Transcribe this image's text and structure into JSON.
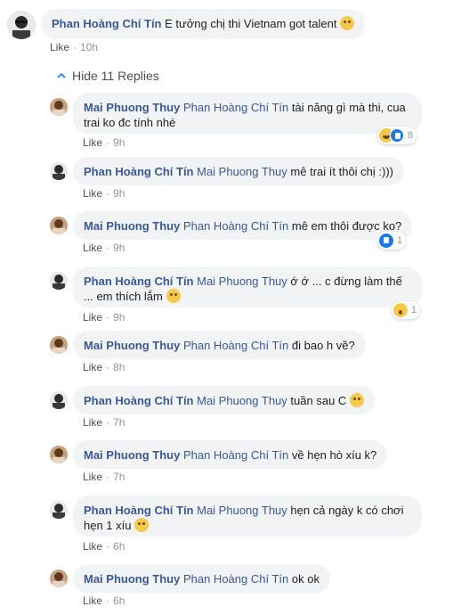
{
  "top_comment": {
    "author": "Phan Hoàng Chí Tín",
    "text": "E tưởng chị thi Vietnam got talent",
    "like_label": "Like",
    "time": "10h"
  },
  "hide_replies_label": "Hide 11 Replies",
  "replies": [
    {
      "author": "Mai Phuong Thuy",
      "mention": "Phan Hoàng Chí Tín",
      "line1": "tài năng gì mà thi, cua",
      "line2": "trai ko đc tính nhé",
      "like_label": "Like",
      "time": "9h",
      "reaction_count": "8"
    },
    {
      "author": "Phan Hoàng Chí Tín",
      "mention": "Mai Phuong Thuy",
      "line1": "mê trai ít thôi chị :)))",
      "like_label": "Like",
      "time": "9h"
    },
    {
      "author": "Mai Phuong Thuy",
      "mention": "Phan Hoàng Chí Tín",
      "line1": "mê em thôi được ko?",
      "like_label": "Like",
      "time": "9h",
      "reaction_count": "1"
    },
    {
      "author": "Phan Hoàng Chí Tín",
      "mention": "Mai Phuong Thuy",
      "line1": "ớ ớ ... c đừng làm thế",
      "line2": "... em thích lắm",
      "like_label": "Like",
      "time": "9h",
      "reaction_count": "1"
    },
    {
      "author": "Mai Phuong Thuy",
      "mention": "Phan Hoàng Chí Tín",
      "line1": "đi bao h về?",
      "like_label": "Like",
      "time": "8h"
    },
    {
      "author": "Phan Hoàng Chí Tín",
      "mention": "Mai Phuong Thuy",
      "line1": "tuần sau C",
      "like_label": "Like",
      "time": "7h"
    },
    {
      "author": "Mai Phuong Thuy",
      "mention": "Phan Hoàng Chí Tín",
      "line1": "về hẹn hò xíu k?",
      "like_label": "Like",
      "time": "7h"
    },
    {
      "author": "Phan Hoàng Chí Tín",
      "mention": "Mai Phuong Thuy",
      "line1": "hẹn cả ngày k có chơi",
      "line2": "hẹn 1 xíu",
      "like_label": "Like",
      "time": "6h"
    },
    {
      "author": "Mai Phuong Thuy",
      "mention": "Phan Hoàng Chí Tín",
      "line1": "ok ok",
      "like_label": "Like",
      "time": "6h"
    }
  ]
}
